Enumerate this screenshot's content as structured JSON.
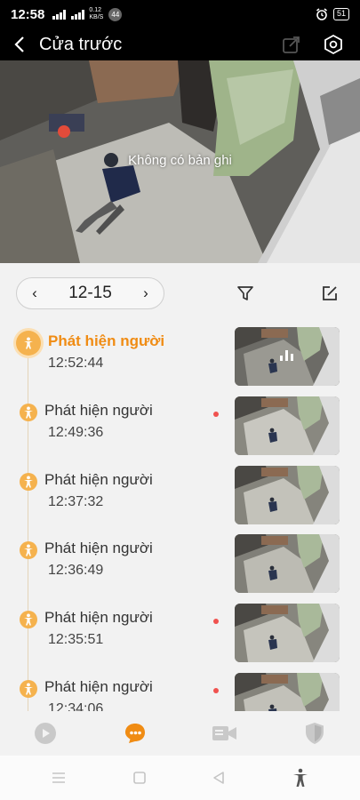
{
  "status_bar": {
    "time": "12:58",
    "net_speed_top": "0.12",
    "net_speed_unit": "KB/S",
    "notif_count": "44",
    "battery": "51"
  },
  "header": {
    "title": "Cửa trước",
    "back_icon": "back-arrow-icon",
    "share_icon": "share-icon",
    "settings_icon": "settings-hex-icon"
  },
  "video": {
    "message": "Không có bản ghi"
  },
  "date_bar": {
    "prev": "‹",
    "date": "12-15",
    "next": "›"
  },
  "events": [
    {
      "title": "Phát hiện người",
      "time": "12:52:44",
      "active": true,
      "unread": false
    },
    {
      "title": "Phát hiện người",
      "time": "12:49:36",
      "active": false,
      "unread": true
    },
    {
      "title": "Phát hiện người",
      "time": "12:37:32",
      "active": false,
      "unread": false
    },
    {
      "title": "Phát hiện người",
      "time": "12:36:49",
      "active": false,
      "unread": false
    },
    {
      "title": "Phát hiện người",
      "time": "12:35:51",
      "active": false,
      "unread": true
    },
    {
      "title": "Phát hiện người",
      "time": "12:34:06",
      "active": false,
      "unread": true
    }
  ],
  "bottom_nav": [
    {
      "name": "live",
      "icon": "play-icon"
    },
    {
      "name": "messages",
      "icon": "chat-icon",
      "active": true
    },
    {
      "name": "devices",
      "icon": "camera-list-icon"
    },
    {
      "name": "security",
      "icon": "shield-icon"
    }
  ],
  "colors": {
    "accent": "#f08c14",
    "event_icon": "#f5b24e",
    "unread_dot": "#f0524f"
  }
}
